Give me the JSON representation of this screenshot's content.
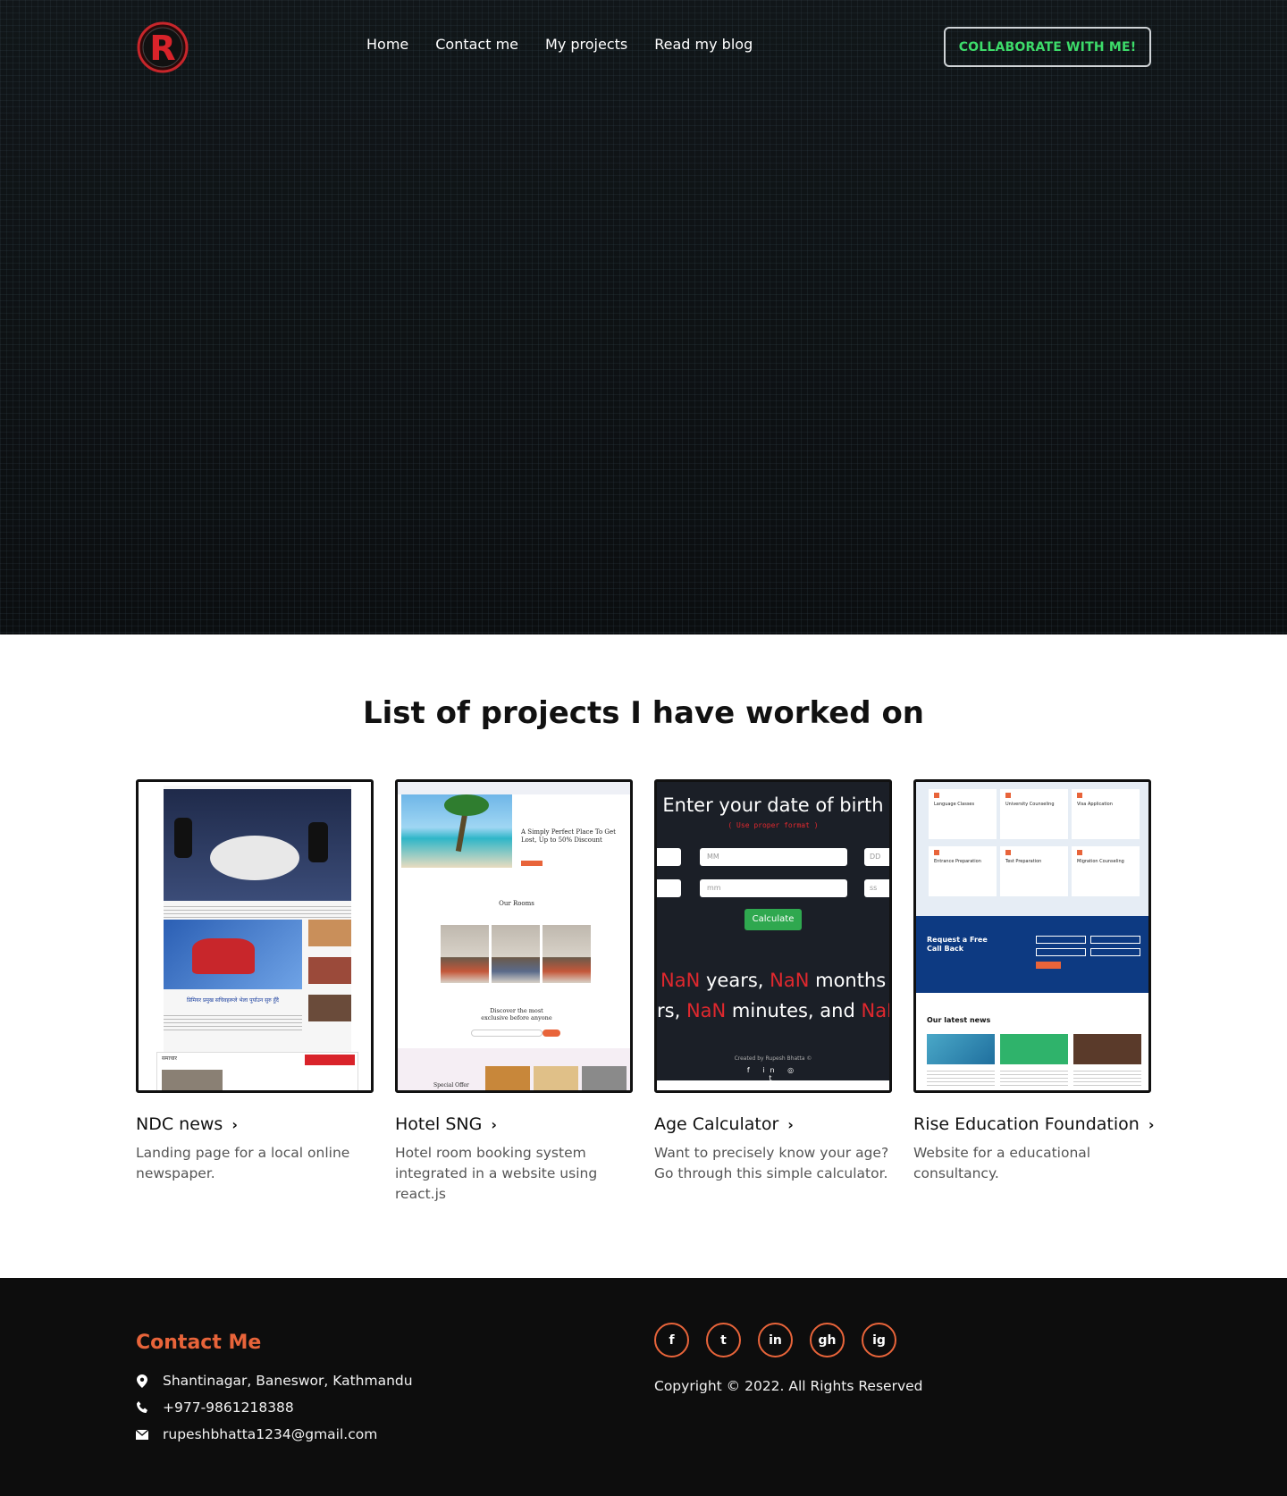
{
  "header": {
    "logo_letter": "R",
    "nav": [
      {
        "label": "Home"
      },
      {
        "label": "Contact me"
      },
      {
        "label": "My projects"
      },
      {
        "label": "Read my blog"
      }
    ],
    "cta_label": "COLLABORATE WITH ME!"
  },
  "projects": {
    "title": "List of projects I have worked on",
    "items": [
      {
        "title": "NDC news",
        "description": "Landing page for a local online newspaper."
      },
      {
        "title": "Hotel SNG",
        "description": "Hotel room booking system integrated in a website using react.js"
      },
      {
        "title": "Age Calculator",
        "description": "Want to precisely know your age? Go through this simple calculator."
      },
      {
        "title": "Rise Education Foundation",
        "description": "Website for a educational consultancy."
      }
    ],
    "thumbs": {
      "hotel": {
        "headline": "A Simply Perfect Place To Get Lost, Up to 50% Discount",
        "rooms": "Our Rooms",
        "discover": "Discover the most exclusive before anyone",
        "special": "Special Offer"
      },
      "age": {
        "heading": "Enter your date of birth",
        "sub": "( Use proper format )",
        "mm": "MM",
        "dd": "DD",
        "min": "mm",
        "ss": "ss",
        "button": "Calculate",
        "nan1": "NaN",
        "years": "years,",
        "nan2": "NaN",
        "months": "months",
        "rs": "rs,",
        "nan3": "NaN",
        "minutes": "minutes, and",
        "nan4": "NaN",
        "credit": "Created by Rupesh Bhatta ©"
      },
      "rise": {
        "callback": "Request a Free Call Back",
        "news": "Our latest news",
        "services": [
          "Language Classes",
          "University Counseling",
          "Visa Application",
          "Entrance Preparation",
          "Test Preparation",
          "Migration Counseling"
        ]
      },
      "ndc": {
        "headline": "प्रिमियर प्रमुख सचिवहरूले भेला पुर्याउन सुरु हुँदै",
        "section": "समाचार"
      }
    }
  },
  "contact": {
    "title": "Contact Me",
    "address": "Shantinagar, Baneswor, Kathmandu",
    "phone": "+977-9861218388",
    "email": "rupeshbhatta1234@gmail.com"
  },
  "socials": [
    {
      "label": "f"
    },
    {
      "label": "t"
    },
    {
      "label": "in"
    },
    {
      "label": "gh"
    },
    {
      "label": "ig"
    }
  ],
  "copyright": "Copyright © 2022. All Rights Reserved",
  "colors": {
    "accent": "#e8643a",
    "cta_text": "#3ddc6a",
    "hero_bg": "#0c0f12",
    "footer_bg": "#0d0d0d"
  }
}
